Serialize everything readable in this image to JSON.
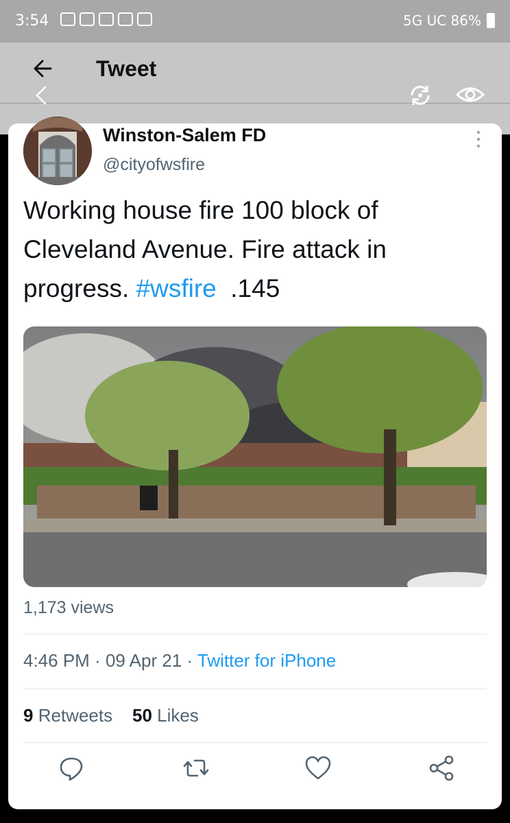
{
  "status_bar": {
    "time": "3:54",
    "right_text": "5G UC 86%"
  },
  "header": {
    "title": "Tweet"
  },
  "tweet": {
    "display_name": "Winston-Salem FD",
    "handle": "@cityofwsfire",
    "text_before_hashtag": "Working house fire 100 block of Cleveland Avenue. Fire attack in progress. ",
    "hashtag": "#wsfire",
    "text_after_hashtag": "  .145",
    "views": "1,173 views",
    "time": "4:46 PM",
    "date": "09 Apr 21",
    "source": "Twitter for iPhone",
    "retweets_count": "9",
    "retweets_label": "Retweets",
    "likes_count": "50",
    "likes_label": "Likes"
  },
  "colors": {
    "accent": "#1d9bf0",
    "secondary_text": "#536471"
  },
  "icons": [
    "back-arrow-icon",
    "chevron-left-icon",
    "refresh-icon",
    "eye-icon",
    "more-icon",
    "reply-icon",
    "retweet-icon",
    "like-icon",
    "share-icon"
  ]
}
